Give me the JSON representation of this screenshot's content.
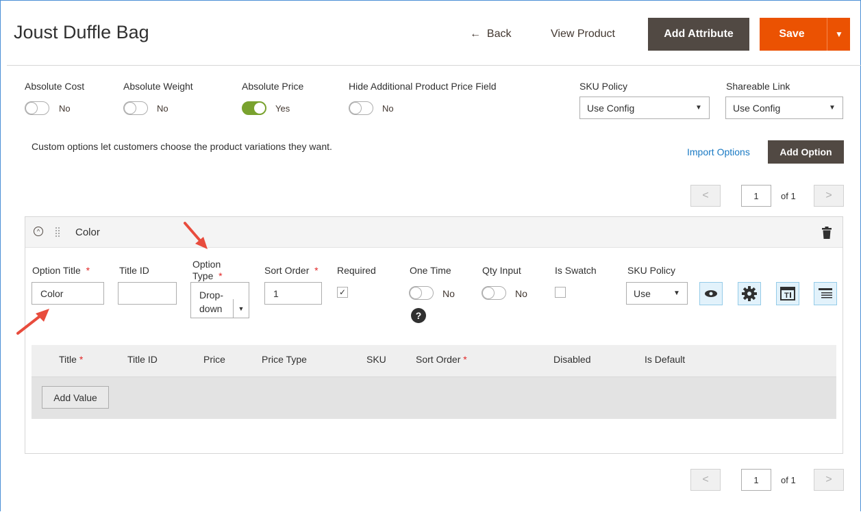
{
  "header": {
    "title": "Joust Duffle Bag",
    "back_label": "Back",
    "back_glyph": "←",
    "view_product_label": "View Product",
    "add_attribute_label": "Add Attribute",
    "save_label": "Save",
    "save_dropdown_glyph": "▼"
  },
  "settings": {
    "absolute_cost": {
      "label": "Absolute Cost",
      "state": "No"
    },
    "absolute_weight": {
      "label": "Absolute Weight",
      "state": "No"
    },
    "absolute_price": {
      "label": "Absolute Price",
      "state": "Yes"
    },
    "hide_price_field": {
      "label": "Hide Additional Product Price Field",
      "state": "No"
    },
    "sku_policy": {
      "label": "SKU Policy",
      "value": "Use Config"
    },
    "shareable_link": {
      "label": "Shareable Link",
      "value": "Use Config"
    }
  },
  "custom_options": {
    "note": "Custom options let customers choose the product variations they want.",
    "import_label": "Import Options",
    "add_option_label": "Add Option"
  },
  "pager": {
    "prev_glyph": "<",
    "next_glyph": ">",
    "page": "1",
    "of_label": "of 1"
  },
  "option": {
    "title": "Color",
    "collapse_glyph": "^",
    "fields": {
      "option_title_label": "Option Title",
      "option_title_value": "Color",
      "title_id_label": "Title ID",
      "option_type_label_1": "Option",
      "option_type_label_2": "Type",
      "option_type_value_1": "Drop-",
      "option_type_value_2": "down",
      "sort_order_label": "Sort Order",
      "sort_order_value": "1",
      "required_label": "Required",
      "required_check": "✓",
      "one_time_label": "One Time",
      "one_time_state": "No",
      "qty_input_label": "Qty Input",
      "qty_input_state": "No",
      "is_swatch_label": "Is Swatch",
      "sku_policy_label": "SKU Policy",
      "sku_policy_value": "Use",
      "help_glyph": "?",
      "required_mark": "*"
    },
    "values_table": {
      "columns": [
        "Title",
        "Title ID",
        "Price",
        "Price Type",
        "SKU",
        "Sort Order",
        "Disabled",
        "Is Default"
      ],
      "add_value_label": "Add Value"
    }
  },
  "colors": {
    "accent": "#eb5202",
    "dark_button": "#514943",
    "toggle_on": "#79a22e",
    "link": "#1979c3",
    "annotation_arrow": "#e84c3d"
  },
  "icons": [
    "arrow-left-icon",
    "chevron-down-icon",
    "collapse-circle-icon",
    "drag-handle-icon",
    "trash-icon",
    "help-icon",
    "eye-icon",
    "gear-icon",
    "text-field-icon",
    "list-icon",
    "checkmark-icon"
  ]
}
